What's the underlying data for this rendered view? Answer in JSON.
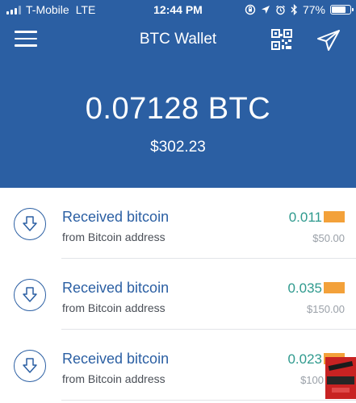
{
  "status_bar": {
    "carrier": "T-Mobile",
    "network": "LTE",
    "time": "12:44 PM",
    "battery": "77%",
    "battery_level": 0.77
  },
  "nav": {
    "title": "BTC Wallet"
  },
  "balance": {
    "crypto": "0.07128 BTC",
    "fiat": "$302.23"
  },
  "transactions": [
    {
      "title": "Received bitcoin",
      "subtitle": "from Bitcoin address",
      "amount": "0.011",
      "fiat": "$50.00"
    },
    {
      "title": "Received bitcoin",
      "subtitle": "from Bitcoin address",
      "amount": "0.035",
      "fiat": "$150.00"
    },
    {
      "title": "Received bitcoin",
      "subtitle": "from Bitcoin address",
      "amount": "0.023",
      "fiat": "$100"
    }
  ],
  "colors": {
    "brand_blue": "#2b5fa3",
    "amount_green": "#2f9a8e",
    "redaction_orange": "#f3a13a"
  },
  "icons": [
    "menu-icon",
    "qr-code-icon",
    "send-icon",
    "receive-arrow-icon",
    "signal-icon",
    "location-icon",
    "alarm-icon",
    "bluetooth-icon",
    "battery-icon",
    "orientation-lock-icon"
  ]
}
